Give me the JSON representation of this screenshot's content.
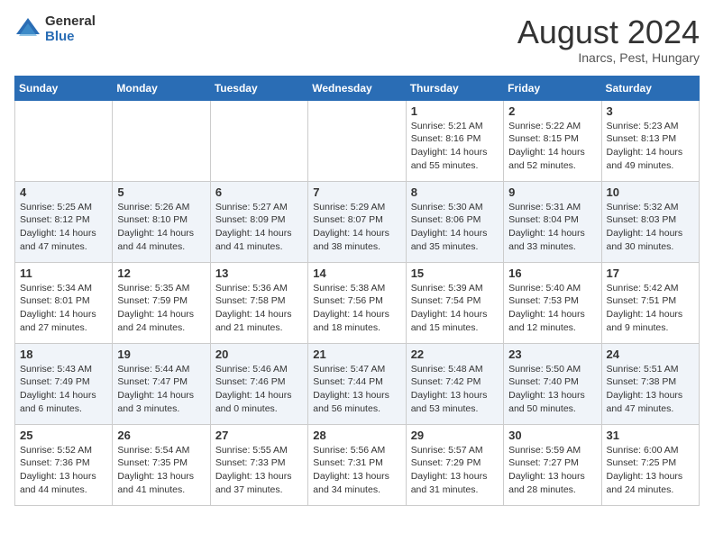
{
  "header": {
    "logo_general": "General",
    "logo_blue": "Blue",
    "month_year": "August 2024",
    "location": "Inarcs, Pest, Hungary"
  },
  "days_of_week": [
    "Sunday",
    "Monday",
    "Tuesday",
    "Wednesday",
    "Thursday",
    "Friday",
    "Saturday"
  ],
  "weeks": [
    [
      {
        "num": "",
        "info": ""
      },
      {
        "num": "",
        "info": ""
      },
      {
        "num": "",
        "info": ""
      },
      {
        "num": "",
        "info": ""
      },
      {
        "num": "1",
        "info": "Sunrise: 5:21 AM\nSunset: 8:16 PM\nDaylight: 14 hours\nand 55 minutes."
      },
      {
        "num": "2",
        "info": "Sunrise: 5:22 AM\nSunset: 8:15 PM\nDaylight: 14 hours\nand 52 minutes."
      },
      {
        "num": "3",
        "info": "Sunrise: 5:23 AM\nSunset: 8:13 PM\nDaylight: 14 hours\nand 49 minutes."
      }
    ],
    [
      {
        "num": "4",
        "info": "Sunrise: 5:25 AM\nSunset: 8:12 PM\nDaylight: 14 hours\nand 47 minutes."
      },
      {
        "num": "5",
        "info": "Sunrise: 5:26 AM\nSunset: 8:10 PM\nDaylight: 14 hours\nand 44 minutes."
      },
      {
        "num": "6",
        "info": "Sunrise: 5:27 AM\nSunset: 8:09 PM\nDaylight: 14 hours\nand 41 minutes."
      },
      {
        "num": "7",
        "info": "Sunrise: 5:29 AM\nSunset: 8:07 PM\nDaylight: 14 hours\nand 38 minutes."
      },
      {
        "num": "8",
        "info": "Sunrise: 5:30 AM\nSunset: 8:06 PM\nDaylight: 14 hours\nand 35 minutes."
      },
      {
        "num": "9",
        "info": "Sunrise: 5:31 AM\nSunset: 8:04 PM\nDaylight: 14 hours\nand 33 minutes."
      },
      {
        "num": "10",
        "info": "Sunrise: 5:32 AM\nSunset: 8:03 PM\nDaylight: 14 hours\nand 30 minutes."
      }
    ],
    [
      {
        "num": "11",
        "info": "Sunrise: 5:34 AM\nSunset: 8:01 PM\nDaylight: 14 hours\nand 27 minutes."
      },
      {
        "num": "12",
        "info": "Sunrise: 5:35 AM\nSunset: 7:59 PM\nDaylight: 14 hours\nand 24 minutes."
      },
      {
        "num": "13",
        "info": "Sunrise: 5:36 AM\nSunset: 7:58 PM\nDaylight: 14 hours\nand 21 minutes."
      },
      {
        "num": "14",
        "info": "Sunrise: 5:38 AM\nSunset: 7:56 PM\nDaylight: 14 hours\nand 18 minutes."
      },
      {
        "num": "15",
        "info": "Sunrise: 5:39 AM\nSunset: 7:54 PM\nDaylight: 14 hours\nand 15 minutes."
      },
      {
        "num": "16",
        "info": "Sunrise: 5:40 AM\nSunset: 7:53 PM\nDaylight: 14 hours\nand 12 minutes."
      },
      {
        "num": "17",
        "info": "Sunrise: 5:42 AM\nSunset: 7:51 PM\nDaylight: 14 hours\nand 9 minutes."
      }
    ],
    [
      {
        "num": "18",
        "info": "Sunrise: 5:43 AM\nSunset: 7:49 PM\nDaylight: 14 hours\nand 6 minutes."
      },
      {
        "num": "19",
        "info": "Sunrise: 5:44 AM\nSunset: 7:47 PM\nDaylight: 14 hours\nand 3 minutes."
      },
      {
        "num": "20",
        "info": "Sunrise: 5:46 AM\nSunset: 7:46 PM\nDaylight: 14 hours\nand 0 minutes."
      },
      {
        "num": "21",
        "info": "Sunrise: 5:47 AM\nSunset: 7:44 PM\nDaylight: 13 hours\nand 56 minutes."
      },
      {
        "num": "22",
        "info": "Sunrise: 5:48 AM\nSunset: 7:42 PM\nDaylight: 13 hours\nand 53 minutes."
      },
      {
        "num": "23",
        "info": "Sunrise: 5:50 AM\nSunset: 7:40 PM\nDaylight: 13 hours\nand 50 minutes."
      },
      {
        "num": "24",
        "info": "Sunrise: 5:51 AM\nSunset: 7:38 PM\nDaylight: 13 hours\nand 47 minutes."
      }
    ],
    [
      {
        "num": "25",
        "info": "Sunrise: 5:52 AM\nSunset: 7:36 PM\nDaylight: 13 hours\nand 44 minutes."
      },
      {
        "num": "26",
        "info": "Sunrise: 5:54 AM\nSunset: 7:35 PM\nDaylight: 13 hours\nand 41 minutes."
      },
      {
        "num": "27",
        "info": "Sunrise: 5:55 AM\nSunset: 7:33 PM\nDaylight: 13 hours\nand 37 minutes."
      },
      {
        "num": "28",
        "info": "Sunrise: 5:56 AM\nSunset: 7:31 PM\nDaylight: 13 hours\nand 34 minutes."
      },
      {
        "num": "29",
        "info": "Sunrise: 5:57 AM\nSunset: 7:29 PM\nDaylight: 13 hours\nand 31 minutes."
      },
      {
        "num": "30",
        "info": "Sunrise: 5:59 AM\nSunset: 7:27 PM\nDaylight: 13 hours\nand 28 minutes."
      },
      {
        "num": "31",
        "info": "Sunrise: 6:00 AM\nSunset: 7:25 PM\nDaylight: 13 hours\nand 24 minutes."
      }
    ]
  ]
}
